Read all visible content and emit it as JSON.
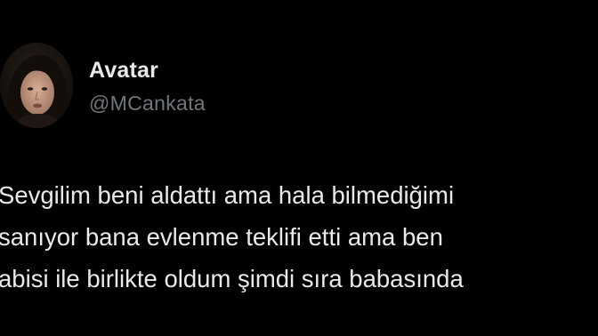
{
  "author": {
    "display_name": "Avatar",
    "handle": "@MCankata",
    "avatar_icon": "profile-photo"
  },
  "tweet": {
    "lines": [
      "Sevgilim beni aldattı ama hala bilmediğimi",
      "sanıyor bana evlenme teklifi etti ama ben",
      "abisi ile birlikte oldum şimdi sıra babasında"
    ]
  },
  "colors": {
    "background": "#000000",
    "text": "#e7e9ea",
    "secondary_text": "#71767b"
  }
}
